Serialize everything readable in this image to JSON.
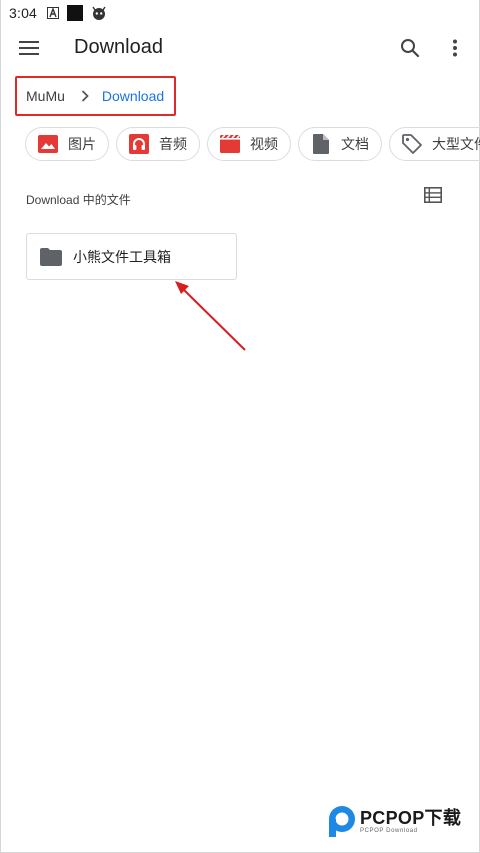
{
  "status_bar": {
    "time": "3:04",
    "icons": [
      "font-icon",
      "black-square-icon",
      "android-robot-icon"
    ]
  },
  "app_bar": {
    "title": "Download",
    "icons": [
      "menu-icon",
      "search-icon",
      "more-vert-icon"
    ]
  },
  "breadcrumb": {
    "root": "MuMu",
    "current": "Download"
  },
  "filter_chips": [
    {
      "label": "图片",
      "icon": "image-icon",
      "color": "#e53935"
    },
    {
      "label": "音频",
      "icon": "headphones-icon",
      "color": "#e53935"
    },
    {
      "label": "视频",
      "icon": "movie-icon",
      "color": "#e53935"
    },
    {
      "label": "文档",
      "icon": "document-icon",
      "color": "#5f6368"
    },
    {
      "label": "大型文件",
      "icon": "tag-icon",
      "color": "#5f6368"
    }
  ],
  "section": {
    "title": "Download 中的文件"
  },
  "files": [
    {
      "name": "小熊文件工具箱",
      "type": "folder",
      "icon": "folder-icon"
    }
  ],
  "watermark": {
    "brand": "PCPOP下载",
    "sub": "PCPOP Download"
  },
  "colors": {
    "accent": "#1a73e8",
    "highlight_box": "#e02a2a",
    "annotation_arrow": "#d91e1e",
    "chip_icon_red": "#e53935"
  }
}
